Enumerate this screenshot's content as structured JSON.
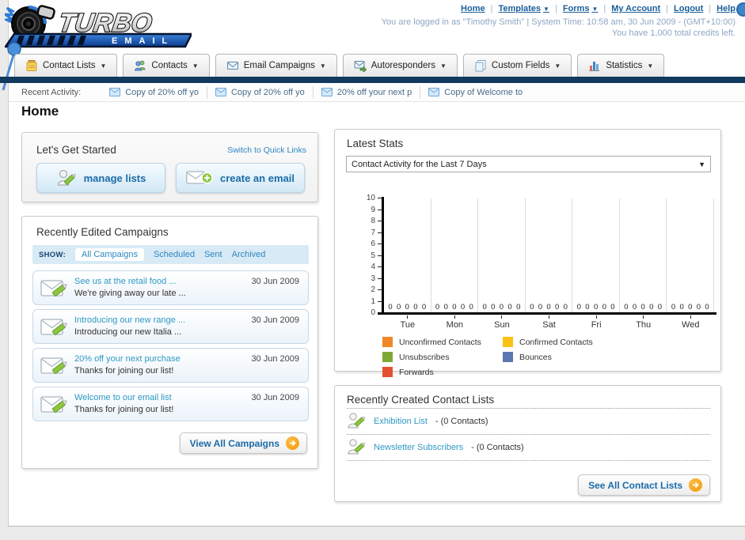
{
  "logo": {
    "title": "TURBO",
    "subtitle": "EMAIL"
  },
  "top_nav": {
    "links": [
      {
        "label": "Home"
      },
      {
        "label": "Templates"
      },
      {
        "label": "Forms"
      },
      {
        "label": "My Account"
      },
      {
        "label": "Logout"
      },
      {
        "label": "Help"
      }
    ],
    "login_line": "You are logged in as \"Timothy Smith\" | System Time: 10:58 am, 30 Jun 2009 - (GMT+10:00)",
    "credits_line": "You have 1,000 total credits left."
  },
  "nav": {
    "tabs": [
      {
        "label": "Contact Lists"
      },
      {
        "label": "Contacts"
      },
      {
        "label": "Email Campaigns"
      },
      {
        "label": "Autoresponders"
      },
      {
        "label": "Custom Fields"
      },
      {
        "label": "Statistics"
      }
    ]
  },
  "recent_activity": {
    "label": "Recent Activity:",
    "items": [
      "Copy of 20% off yo",
      "Copy of 20% off yo",
      "20% off your next p",
      "Copy of Welcome to"
    ]
  },
  "page": {
    "title": "Home"
  },
  "get_started": {
    "title": "Let's Get Started",
    "switch_link": "Switch to Quick Links",
    "manage_lists_label": "manage lists",
    "create_email_label": "create an email"
  },
  "campaigns": {
    "title": "Recently Edited Campaigns",
    "filter_label": "SHOW:",
    "filters": [
      "All Campaigns",
      "Scheduled",
      "Sent",
      "Archived"
    ],
    "active_filter": "All Campaigns",
    "items": [
      {
        "title": "See us at the retail food ...",
        "subtitle": "We're giving away our late ...",
        "date": "30 Jun 2009"
      },
      {
        "title": "Introducing our new range ...",
        "subtitle": "Introducing our new Italia ...",
        "date": "30 Jun 2009"
      },
      {
        "title": "20% off your next purchase",
        "subtitle": "Thanks for joining our list!",
        "date": "30 Jun 2009"
      },
      {
        "title": "Welcome to our email list",
        "subtitle": "Thanks for joining our list!",
        "date": "30 Jun 2009"
      }
    ],
    "view_all_label": "View All Campaigns"
  },
  "stats": {
    "title": "Latest Stats",
    "dropdown_value": "Contact Activity for the Last 7 Days"
  },
  "chart_data": {
    "type": "bar",
    "title": "Contact Activity for the Last 7 Days",
    "categories": [
      "Tue",
      "Mon",
      "Sun",
      "Sat",
      "Fri",
      "Thu",
      "Wed"
    ],
    "series": [
      {
        "name": "Unconfirmed Contacts",
        "color": "#EF8829",
        "values": [
          0,
          0,
          0,
          0,
          0,
          0,
          0
        ]
      },
      {
        "name": "Confirmed Contacts",
        "color": "#F9C214",
        "values": [
          0,
          0,
          0,
          0,
          0,
          0,
          0
        ]
      },
      {
        "name": "Unsubscribes",
        "color": "#7FA937",
        "values": [
          0,
          0,
          0,
          0,
          0,
          0,
          0
        ]
      },
      {
        "name": "Bounces",
        "color": "#5B78B1",
        "values": [
          0,
          0,
          0,
          0,
          0,
          0,
          0
        ]
      },
      {
        "name": "Forwards",
        "color": "#E3502E",
        "values": [
          0,
          0,
          0,
          0,
          0,
          0,
          0
        ]
      }
    ],
    "ylim": [
      0,
      10
    ],
    "ytick_step": 1,
    "grid": "vertical",
    "legend_position": "bottom",
    "xlabel": "",
    "ylabel": ""
  },
  "contact_lists": {
    "title": "Recently Created Contact Lists",
    "items": [
      {
        "name": "Exhibition List",
        "suffix": "- (0 Contacts)"
      },
      {
        "name": "Newsletter Subscribers",
        "suffix": "- (0 Contacts)"
      }
    ],
    "see_all_label": "See All Contact Lists"
  },
  "colors": {
    "navy_bar": "#12395E",
    "link_blue": "#1A5E9A",
    "campaign_link": "#2F99C4",
    "button_text": "#1B6CA8",
    "orange_accent": "#F5A31A"
  }
}
